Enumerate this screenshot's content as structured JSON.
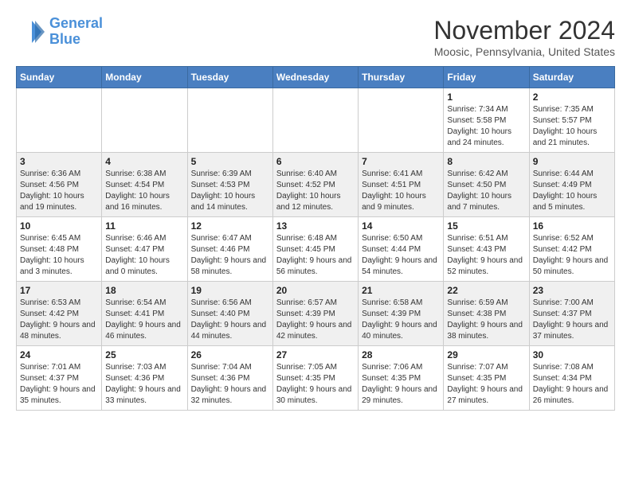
{
  "logo": {
    "line1": "General",
    "line2": "Blue"
  },
  "header": {
    "month": "November 2024",
    "location": "Moosic, Pennsylvania, United States"
  },
  "weekdays": [
    "Sunday",
    "Monday",
    "Tuesday",
    "Wednesday",
    "Thursday",
    "Friday",
    "Saturday"
  ],
  "weeks": [
    [
      {
        "day": "",
        "info": ""
      },
      {
        "day": "",
        "info": ""
      },
      {
        "day": "",
        "info": ""
      },
      {
        "day": "",
        "info": ""
      },
      {
        "day": "",
        "info": ""
      },
      {
        "day": "1",
        "info": "Sunrise: 7:34 AM\nSunset: 5:58 PM\nDaylight: 10 hours and 24 minutes."
      },
      {
        "day": "2",
        "info": "Sunrise: 7:35 AM\nSunset: 5:57 PM\nDaylight: 10 hours and 21 minutes."
      }
    ],
    [
      {
        "day": "3",
        "info": "Sunrise: 6:36 AM\nSunset: 4:56 PM\nDaylight: 10 hours and 19 minutes."
      },
      {
        "day": "4",
        "info": "Sunrise: 6:38 AM\nSunset: 4:54 PM\nDaylight: 10 hours and 16 minutes."
      },
      {
        "day": "5",
        "info": "Sunrise: 6:39 AM\nSunset: 4:53 PM\nDaylight: 10 hours and 14 minutes."
      },
      {
        "day": "6",
        "info": "Sunrise: 6:40 AM\nSunset: 4:52 PM\nDaylight: 10 hours and 12 minutes."
      },
      {
        "day": "7",
        "info": "Sunrise: 6:41 AM\nSunset: 4:51 PM\nDaylight: 10 hours and 9 minutes."
      },
      {
        "day": "8",
        "info": "Sunrise: 6:42 AM\nSunset: 4:50 PM\nDaylight: 10 hours and 7 minutes."
      },
      {
        "day": "9",
        "info": "Sunrise: 6:44 AM\nSunset: 4:49 PM\nDaylight: 10 hours and 5 minutes."
      }
    ],
    [
      {
        "day": "10",
        "info": "Sunrise: 6:45 AM\nSunset: 4:48 PM\nDaylight: 10 hours and 3 minutes."
      },
      {
        "day": "11",
        "info": "Sunrise: 6:46 AM\nSunset: 4:47 PM\nDaylight: 10 hours and 0 minutes."
      },
      {
        "day": "12",
        "info": "Sunrise: 6:47 AM\nSunset: 4:46 PM\nDaylight: 9 hours and 58 minutes."
      },
      {
        "day": "13",
        "info": "Sunrise: 6:48 AM\nSunset: 4:45 PM\nDaylight: 9 hours and 56 minutes."
      },
      {
        "day": "14",
        "info": "Sunrise: 6:50 AM\nSunset: 4:44 PM\nDaylight: 9 hours and 54 minutes."
      },
      {
        "day": "15",
        "info": "Sunrise: 6:51 AM\nSunset: 4:43 PM\nDaylight: 9 hours and 52 minutes."
      },
      {
        "day": "16",
        "info": "Sunrise: 6:52 AM\nSunset: 4:42 PM\nDaylight: 9 hours and 50 minutes."
      }
    ],
    [
      {
        "day": "17",
        "info": "Sunrise: 6:53 AM\nSunset: 4:42 PM\nDaylight: 9 hours and 48 minutes."
      },
      {
        "day": "18",
        "info": "Sunrise: 6:54 AM\nSunset: 4:41 PM\nDaylight: 9 hours and 46 minutes."
      },
      {
        "day": "19",
        "info": "Sunrise: 6:56 AM\nSunset: 4:40 PM\nDaylight: 9 hours and 44 minutes."
      },
      {
        "day": "20",
        "info": "Sunrise: 6:57 AM\nSunset: 4:39 PM\nDaylight: 9 hours and 42 minutes."
      },
      {
        "day": "21",
        "info": "Sunrise: 6:58 AM\nSunset: 4:39 PM\nDaylight: 9 hours and 40 minutes."
      },
      {
        "day": "22",
        "info": "Sunrise: 6:59 AM\nSunset: 4:38 PM\nDaylight: 9 hours and 38 minutes."
      },
      {
        "day": "23",
        "info": "Sunrise: 7:00 AM\nSunset: 4:37 PM\nDaylight: 9 hours and 37 minutes."
      }
    ],
    [
      {
        "day": "24",
        "info": "Sunrise: 7:01 AM\nSunset: 4:37 PM\nDaylight: 9 hours and 35 minutes."
      },
      {
        "day": "25",
        "info": "Sunrise: 7:03 AM\nSunset: 4:36 PM\nDaylight: 9 hours and 33 minutes."
      },
      {
        "day": "26",
        "info": "Sunrise: 7:04 AM\nSunset: 4:36 PM\nDaylight: 9 hours and 32 minutes."
      },
      {
        "day": "27",
        "info": "Sunrise: 7:05 AM\nSunset: 4:35 PM\nDaylight: 9 hours and 30 minutes."
      },
      {
        "day": "28",
        "info": "Sunrise: 7:06 AM\nSunset: 4:35 PM\nDaylight: 9 hours and 29 minutes."
      },
      {
        "day": "29",
        "info": "Sunrise: 7:07 AM\nSunset: 4:35 PM\nDaylight: 9 hours and 27 minutes."
      },
      {
        "day": "30",
        "info": "Sunrise: 7:08 AM\nSunset: 4:34 PM\nDaylight: 9 hours and 26 minutes."
      }
    ]
  ]
}
